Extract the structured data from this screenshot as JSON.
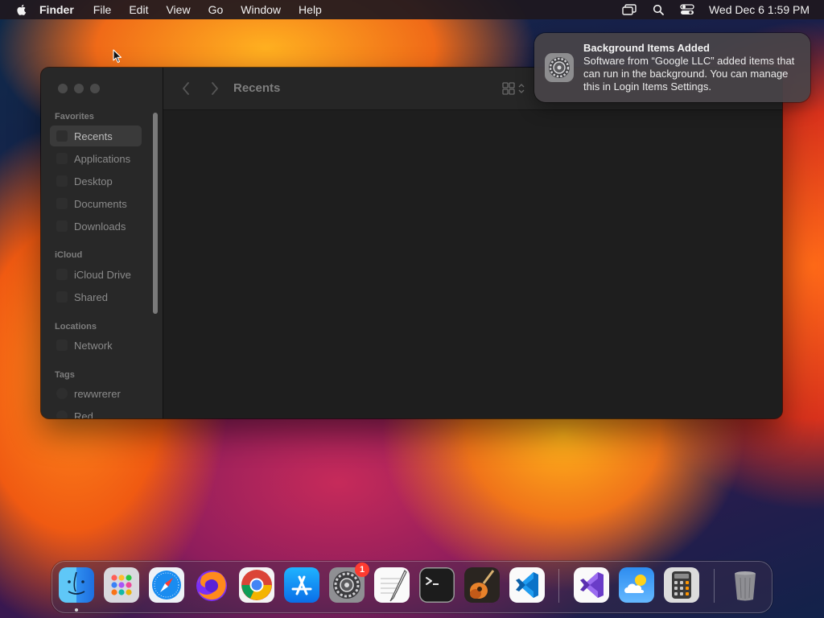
{
  "menubar": {
    "app_name": "Finder",
    "menus": [
      "File",
      "Edit",
      "View",
      "Go",
      "Window",
      "Help"
    ],
    "status_icons": [
      "screen-mirroring-icon",
      "spotlight-search-icon",
      "control-center-icon"
    ],
    "clock": "Wed Dec 6  1:59 PM"
  },
  "finder": {
    "title": "Recents",
    "sidebar": {
      "favorites_header": "Favorites",
      "favorites": [
        "Recents",
        "Applications",
        "Desktop",
        "Documents",
        "Downloads"
      ],
      "icloud_header": "iCloud",
      "icloud": [
        "iCloud Drive",
        "Shared"
      ],
      "locations_header": "Locations",
      "locations": [
        "Network"
      ],
      "tags_header": "Tags",
      "tags": [
        "rewwrerer",
        "Red"
      ]
    }
  },
  "notification": {
    "title": "Background Items Added",
    "body": "Software from “Google LLC” added items that can run in the background. You can manage this in Login Items Settings.",
    "icon": "system-settings-icon"
  },
  "dock": {
    "apps": [
      "Finder",
      "Launchpad",
      "Safari",
      "Firefox",
      "Google Chrome",
      "App Store",
      "System Settings",
      "TextEdit",
      "Terminal",
      "GarageBand",
      "Visual Studio Code",
      "Visual Studio",
      "Weather",
      "Calculator",
      "Trash"
    ],
    "settings_badge": "1"
  }
}
